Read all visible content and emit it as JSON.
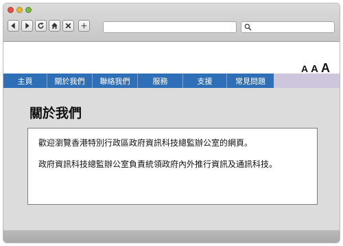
{
  "browser": {
    "search_placeholder": ""
  },
  "font_sizer": {
    "small": "A",
    "medium": "A",
    "large": "A"
  },
  "menu": {
    "items": [
      {
        "label": "主頁"
      },
      {
        "label": "關於我們"
      },
      {
        "label": "聯絡我們"
      },
      {
        "label": "服務"
      },
      {
        "label": "支援"
      },
      {
        "label": "常見問題"
      }
    ]
  },
  "page": {
    "title": "關於我們",
    "paragraphs": [
      "歡迎瀏覽香港特別行政區政府資訊科技總監辦公室的網頁。",
      "政府資訊科技總監辦公室負責統領政府內外推行資訊及通訊科技。"
    ]
  },
  "colors": {
    "menu_bg": "#2f6fb7",
    "menu_bar_tail": "#cdc6dc",
    "content_bg": "#dcdcdc"
  }
}
